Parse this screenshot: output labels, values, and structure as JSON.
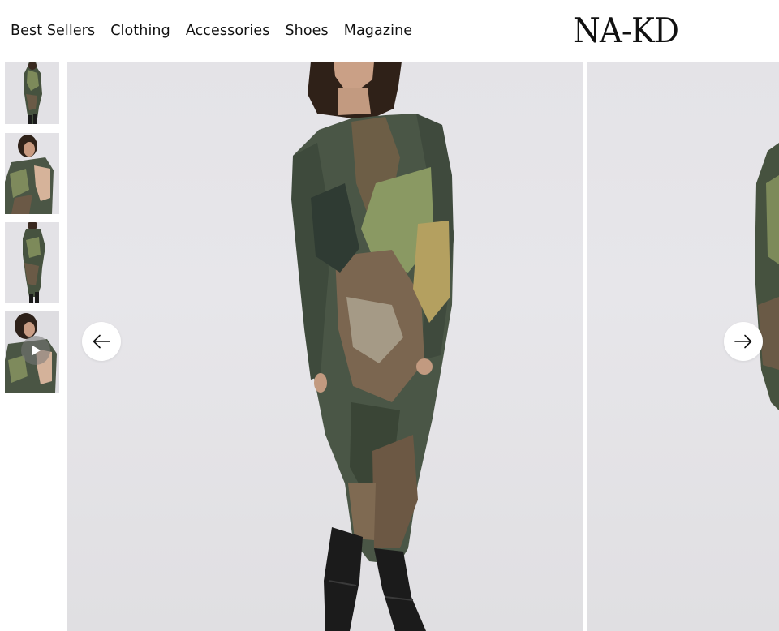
{
  "brand": {
    "logo_text": "NA-KD"
  },
  "nav": {
    "items": [
      "Best Sellers",
      "Clothing",
      "Accessories",
      "Shoes",
      "Magazine"
    ]
  },
  "thumbnails": [
    {
      "kind": "image",
      "alt": ""
    },
    {
      "kind": "image",
      "alt": ""
    },
    {
      "kind": "image",
      "alt": ""
    },
    {
      "kind": "video",
      "alt": ""
    }
  ],
  "gallery": {
    "prev_icon": "arrow-left-icon",
    "next_icon": "arrow-right-icon",
    "play_icon": "play-icon"
  },
  "colors": {
    "background": "#ffffff",
    "photo_backdrop": "#e5e4e8",
    "dress_dark": "#3d4a3e",
    "dress_olive": "#7f8c5c",
    "dress_brown": "#6e5a45",
    "boots": "#1a1a1a"
  }
}
